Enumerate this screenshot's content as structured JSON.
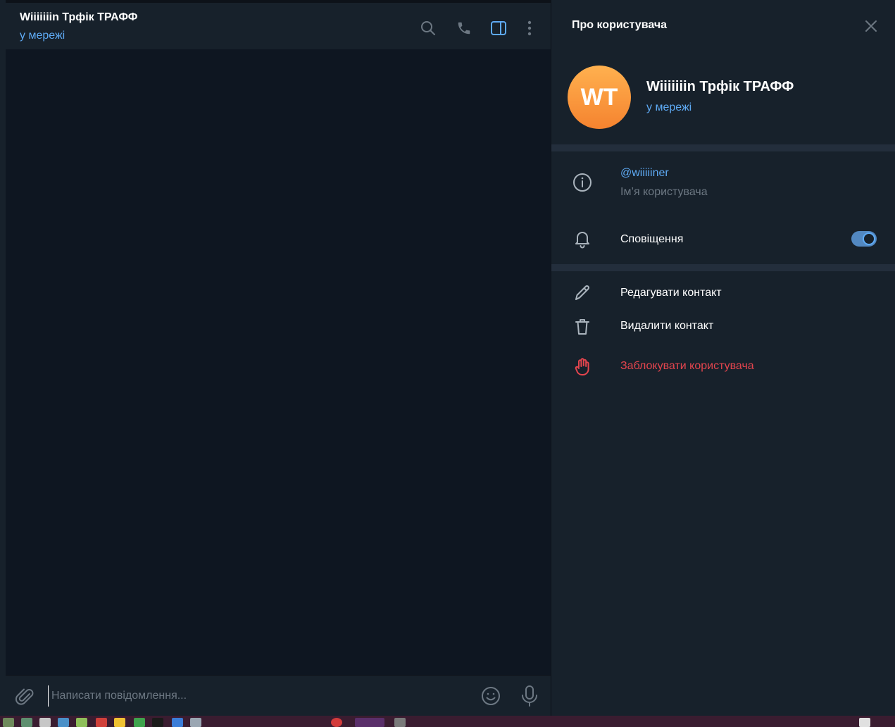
{
  "chat": {
    "title": "Wiiiiiiin Трфік ТРАФФ",
    "status": "у мережі",
    "header_icons": [
      "search-icon",
      "phone-icon",
      "sidebar-toggle-icon",
      "more-vertical-icon"
    ],
    "composer_placeholder": "Написати повідомлення..."
  },
  "panel": {
    "title": "Про користувача",
    "avatar_initials": "WT",
    "name": "Wiiiiiiin Трфік ТРАФФ",
    "status": "у мережі",
    "username": "@wiiiiiner",
    "username_label": "Ім’я користувача",
    "notifications_label": "Сповіщення",
    "notifications_enabled": true,
    "actions": {
      "edit": "Редагувати контакт",
      "delete": "Видалити контакт",
      "block": "Заблокувати користувача"
    }
  },
  "colors": {
    "accent": "#5eaaf4",
    "background": "#17212b",
    "chat_background": "#0e1621",
    "danger": "#e5454e",
    "avatar_gradient": [
      "#ffb14f",
      "#f5832f"
    ]
  }
}
